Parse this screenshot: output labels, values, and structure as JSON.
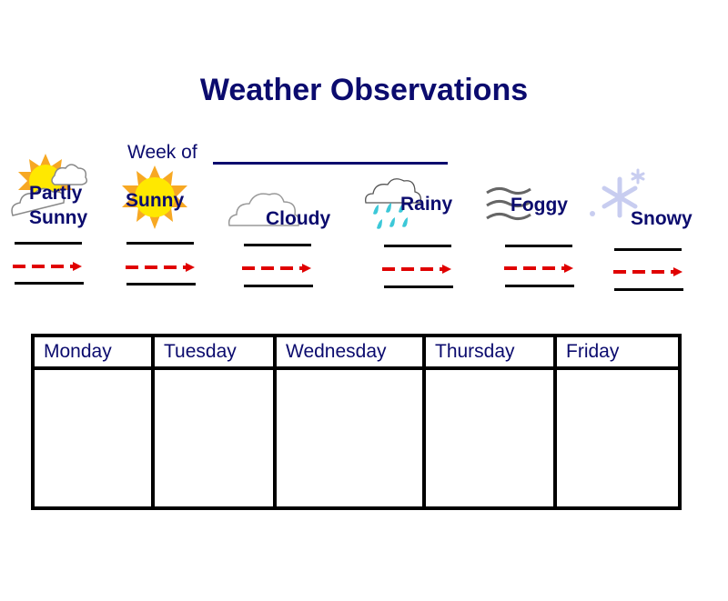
{
  "header": {
    "title": "Weather Observations",
    "week_label": "Week of",
    "week_value": ""
  },
  "weather_types": [
    {
      "id": "partly-sunny",
      "label_line1": "Partly",
      "label_line2": "Sunny",
      "icon": "partly-sunny-icon"
    },
    {
      "id": "sunny",
      "label": "Sunny",
      "icon": "sun-icon"
    },
    {
      "id": "cloudy",
      "label": "Cloudy",
      "icon": "cloud-icon"
    },
    {
      "id": "rainy",
      "label": "Rainy",
      "icon": "rain-cloud-icon"
    },
    {
      "id": "foggy",
      "label": "Foggy",
      "icon": "fog-icon"
    },
    {
      "id": "snowy",
      "label": "Snowy",
      "icon": "snowflake-icon"
    }
  ],
  "table": {
    "columns": [
      "Monday",
      "Tuesday",
      "Wednesday",
      "Thursday",
      "Friday"
    ],
    "cells": [
      "",
      "",
      "",
      "",
      ""
    ]
  },
  "colors": {
    "text": "#0b0b6e",
    "arrow": "#e00000",
    "sun": "#ffe800",
    "sun_rays": "#f7a823",
    "rain": "#3cc8d8",
    "snow": "#c8cdf0"
  }
}
